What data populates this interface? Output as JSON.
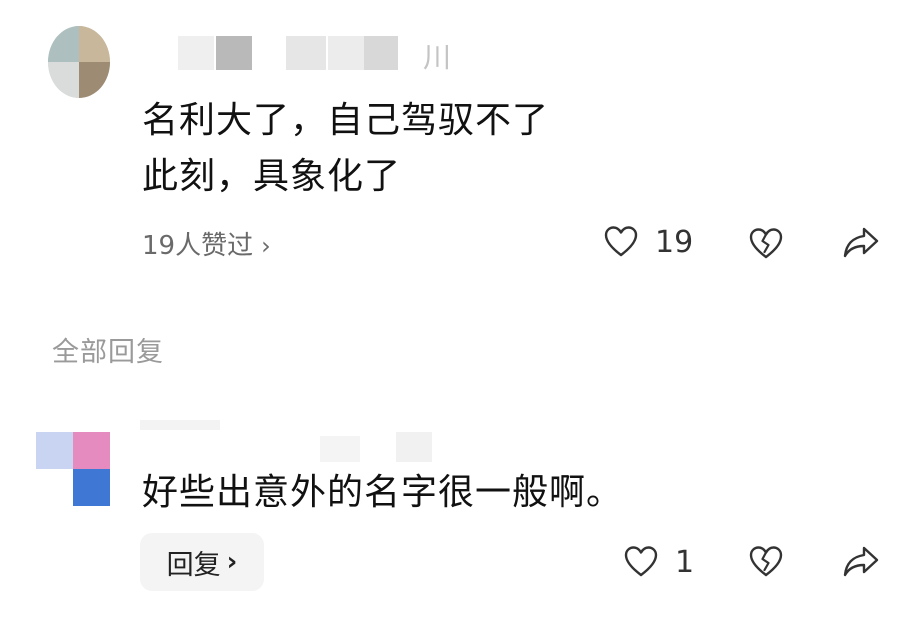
{
  "comment_top": {
    "author_suffix": "川",
    "text_lines": [
      "名利大了，自己驾驭不了",
      "此刻，具象化了"
    ],
    "likers_text": "19人赞过",
    "likers_chevron": "›",
    "like_count": "19",
    "icons": [
      "heart-icon",
      "broken-heart-icon",
      "share-icon"
    ]
  },
  "section": {
    "title": "全部回复"
  },
  "reply": {
    "text": "好些出意外的名字很一般啊。",
    "like_count": "1",
    "reply_button_label": "回复",
    "reply_button_chevron": "›",
    "icons": [
      "heart-icon",
      "broken-heart-icon",
      "share-icon"
    ]
  },
  "colors": {
    "text_primary": "#111111",
    "text_secondary": "#6a6a6a",
    "section_title": "#9a9a9a",
    "icon_stroke": "#333333",
    "reply_button_bg": "#f4f4f4"
  }
}
